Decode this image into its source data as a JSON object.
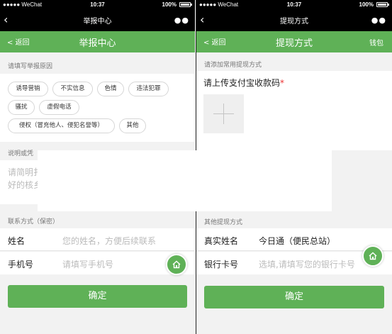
{
  "colors": {
    "brand_green": "#5fb157",
    "page_bg": "#f2f2f2"
  },
  "left": {
    "status": {
      "carrier": "●●●●● WeChat",
      "time": "10:37",
      "battery": "100%"
    },
    "wx_header": {
      "back_icon": "chevron-left-icon",
      "title": "举报中心",
      "capsule": "●●"
    },
    "header": {
      "back": "< 返回",
      "title": "举报中心"
    },
    "reason_label": "请填写举报原因",
    "tags": [
      "诱导营销",
      "不实信息",
      "色情",
      "违法犯罪",
      "骚扰",
      "虚假电话",
      "侵权（冒充他人、侵犯名誉等）",
      "其他"
    ],
    "desc_label": "说明或凭",
    "desc_placeholder_1": "请简明扌",
    "desc_placeholder_2": "好的核乡",
    "contact_label": "联系方式（保密）",
    "name": {
      "label": "姓名",
      "placeholder": "您的姓名，方便后续联系"
    },
    "phone": {
      "label": "手机号",
      "placeholder": "请填写手机号"
    },
    "home_icon": "home-icon",
    "confirm": "确定"
  },
  "right": {
    "status": {
      "carrier": "●●●●● WeChat",
      "time": "10:37",
      "battery": "100%"
    },
    "wx_header": {
      "back_icon": "chevron-left-icon",
      "title": "提现方式",
      "capsule": "●●"
    },
    "header": {
      "back": "< 返回",
      "title": "提现方式",
      "wallet": "钱包"
    },
    "add_label": "请添加常用提现方式",
    "upload_title": "请上传支付宝收款码",
    "required_mark": "*",
    "upload_icon": "plus-icon",
    "other_label": "其他提现方式",
    "real_name": {
      "label": "真实姓名",
      "value": "今日通（便民总站）"
    },
    "bank_card": {
      "label": "银行卡号",
      "placeholder": "选填,请填写您的银行卡号"
    },
    "home_icon": "home-icon",
    "confirm": "确定"
  }
}
